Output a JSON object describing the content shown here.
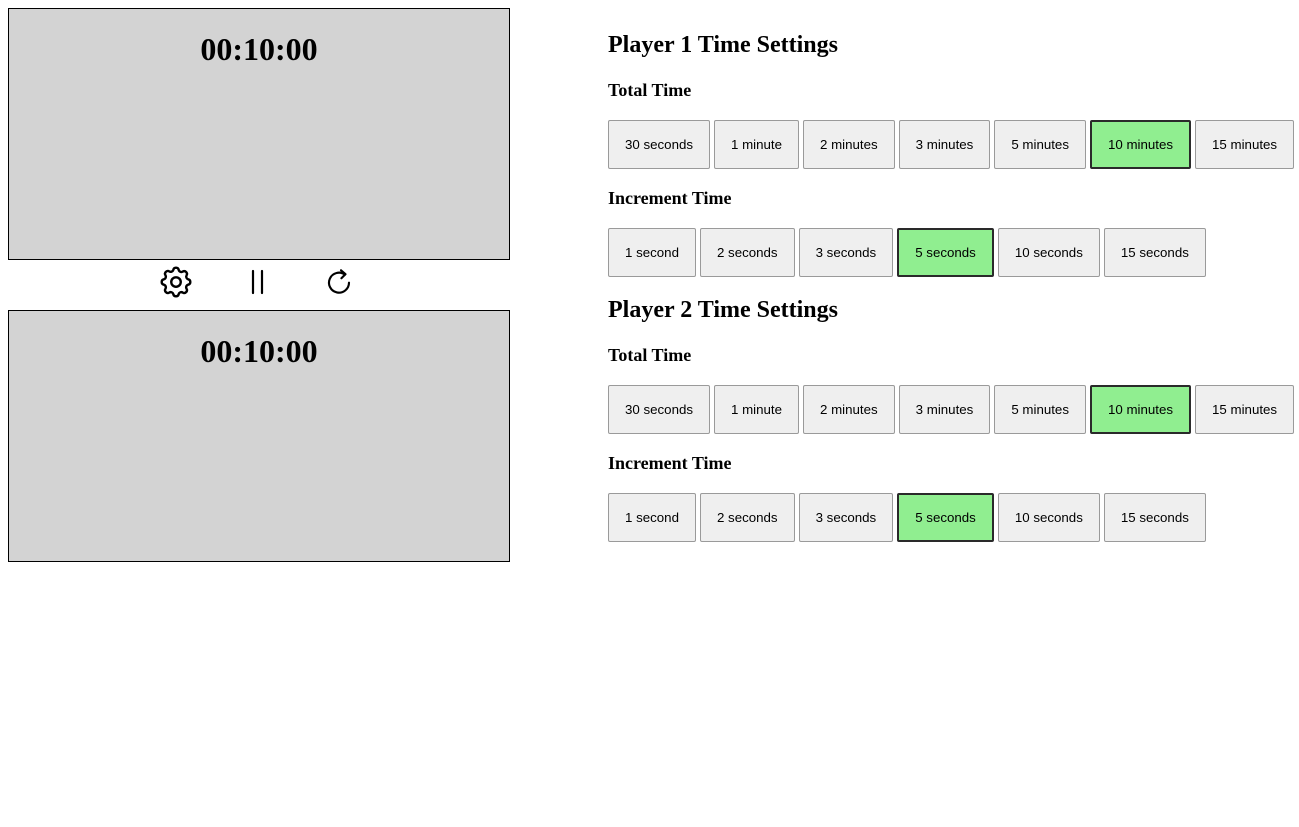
{
  "clocks": {
    "top": {
      "time": "00:10:00"
    },
    "bottom": {
      "time": "00:10:00"
    }
  },
  "controls": {
    "settings_icon": "gear-icon",
    "pause_icon": "pause-icon",
    "reset_icon": "reset-icon"
  },
  "player1": {
    "heading": "Player 1 Time Settings",
    "total_time_label": "Total Time",
    "total_time_options": [
      "30 seconds",
      "1 minute",
      "2 minutes",
      "3 minutes",
      "5 minutes",
      "10 minutes",
      "15 minutes"
    ],
    "total_time_selected": "10 minutes",
    "increment_label": "Increment Time",
    "increment_options": [
      "1 second",
      "2 seconds",
      "3 seconds",
      "5 seconds",
      "10 seconds",
      "15 seconds"
    ],
    "increment_selected": "5 seconds"
  },
  "player2": {
    "heading": "Player 2 Time Settings",
    "total_time_label": "Total Time",
    "total_time_options": [
      "30 seconds",
      "1 minute",
      "2 minutes",
      "3 minutes",
      "5 minutes",
      "10 minutes",
      "15 minutes"
    ],
    "total_time_selected": "10 minutes",
    "increment_label": "Increment Time",
    "increment_options": [
      "1 second",
      "2 seconds",
      "3 seconds",
      "5 seconds",
      "10 seconds",
      "15 seconds"
    ],
    "increment_selected": "5 seconds"
  },
  "colors": {
    "clock_bg": "#d3d3d3",
    "button_bg": "#efefef",
    "selected_bg": "#90ee90"
  }
}
